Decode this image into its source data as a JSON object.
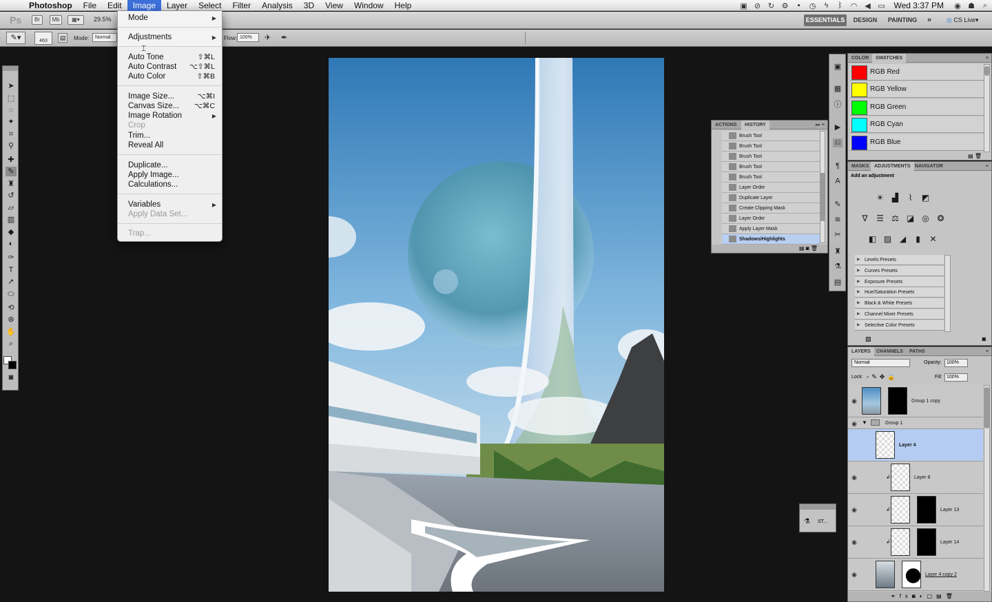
{
  "mac_menu": {
    "items": [
      "Photoshop",
      "File",
      "Edit",
      "Image",
      "Layer",
      "Select",
      "Filter",
      "Analysis",
      "3D",
      "View",
      "Window",
      "Help"
    ],
    "clock": "Wed 3:37 PM"
  },
  "app_bar": {
    "ps": "Ps",
    "br": "Br",
    "mb": "Mb",
    "zoom": "29.5%",
    "workspaces": [
      "ESSENTIALS",
      "DESIGN",
      "PAINTING"
    ],
    "more": "»",
    "cs_live": "CS Live"
  },
  "options_bar": {
    "size": "463",
    "mode_label": "Mode:",
    "mode_value": "Normal",
    "flow_label": "Flow:",
    "flow_value": "100%"
  },
  "image_menu": {
    "mode": "Mode",
    "adjustments": "Adjustments",
    "auto_tone": "Auto Tone",
    "auto_tone_sc": "⇧⌘L",
    "auto_contrast": "Auto Contrast",
    "auto_contrast_sc": "⌥⇧⌘L",
    "auto_color": "Auto Color",
    "auto_color_sc": "⇧⌘B",
    "image_size": "Image Size...",
    "image_size_sc": "⌥⌘I",
    "canvas_size": "Canvas Size...",
    "canvas_size_sc": "⌥⌘C",
    "image_rotation": "Image Rotation",
    "crop": "Crop",
    "trim": "Trim...",
    "reveal_all": "Reveal All",
    "duplicate": "Duplicate...",
    "apply_image": "Apply Image...",
    "calculations": "Calculations...",
    "variables": "Variables",
    "apply_data_set": "Apply Data Set...",
    "trap": "Trap..."
  },
  "history": {
    "tabs": [
      "ACTIONS",
      "HISTORY"
    ],
    "steps": [
      "Brush Tool",
      "Brush Tool",
      "Brush Tool",
      "Brush Tool",
      "Brush Tool",
      "Layer Order",
      "Duplicate Layer",
      "Create Clipping Mask",
      "Layer Order",
      "Apply Layer Mask",
      "Shadows/Highlights"
    ]
  },
  "swatches": {
    "tabs": [
      "COLOR",
      "SWATCHES"
    ],
    "items": [
      {
        "name": "RGB Red",
        "color": "#ff0000"
      },
      {
        "name": "RGB Yellow",
        "color": "#ffff00"
      },
      {
        "name": "RGB Green",
        "color": "#00ff00"
      },
      {
        "name": "RGB Cyan",
        "color": "#00ffff"
      },
      {
        "name": "RGB Blue",
        "color": "#0000ff"
      }
    ]
  },
  "adjustments": {
    "tabs": [
      "MASKS",
      "ADJUSTMENTS",
      "NAVIGATOR"
    ],
    "heading": "Add an adjustment",
    "presets": [
      "Levels Presets",
      "Curves Presets",
      "Exposure Presets",
      "Hue/Saturation Presets",
      "Black & White Presets",
      "Channel Mixer Presets",
      "Selective Color Presets"
    ]
  },
  "layers": {
    "tabs": [
      "LAYERS",
      "CHANNELS",
      "PATHS"
    ],
    "blend": "Normal",
    "opacity_label": "Opacity:",
    "opacity": "100%",
    "lock_label": "Lock:",
    "fill_label": "Fill:",
    "fill": "100%",
    "items": [
      "Group 1 copy",
      "Group 1",
      "Layer 4",
      "Layer 8",
      "Layer 13",
      "Layer 14",
      "Layer 4 copy 2"
    ]
  },
  "float_panel": {
    "label": "ST..."
  }
}
